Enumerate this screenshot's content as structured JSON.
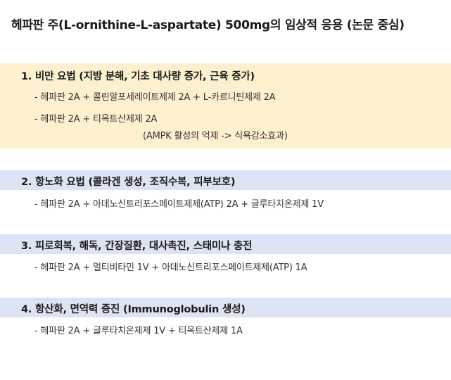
{
  "title": "헤파판 주(L-ornithine-L-aspartate) 500mg의 임상적 응용 (논문 중심)",
  "sections": [
    {
      "heading": "1. 비만 요법 (지방 분해, 기초 대사량 증가, 근육 증가)",
      "items": [
        "- 헤파판 2A + 콜린알포세레이트제제 2A + L-카르니틴제제 2A",
        "- 헤파판 2A + 티옥트산제제 2A"
      ],
      "note": "(AMPK 활성의 억제 -> 식욕감소효과)",
      "background": "#fcf0cf"
    },
    {
      "heading": "2. 항노화 요법 (콜라겐 생성, 조직수복, 피부보호)",
      "items": [
        "- 헤파판 2A + 아데노신트리포스페이트제제(ATP) 2A + 글루타치온제제 1V"
      ],
      "background": "#dce3f3"
    },
    {
      "heading": "3. 피로회복, 해독, 간장질환, 대사촉진, 스태미나 충전",
      "items": [
        "- 헤파판 2A + 멀티비타민 1V + 아데노신트리포스페이트제제(ATP) 1A"
      ],
      "background": "#dce3f3"
    },
    {
      "heading": "4. 항산화, 면역력 증진 (Immunoglobulin 생성)",
      "items": [
        "- 헤파판 2A + 글루타치온제제 1V + 티옥트산제제 1A"
      ],
      "background": "#dce3f3"
    }
  ]
}
